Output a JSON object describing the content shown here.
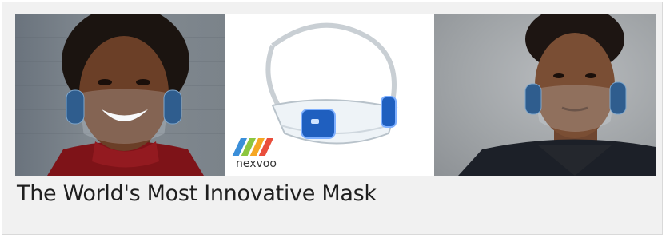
{
  "card": {
    "title": "The World's Most Innovative Mask"
  },
  "images": [
    {
      "name": "woman-wearing-mask"
    },
    {
      "name": "mask-product"
    },
    {
      "name": "man-wearing-mask"
    }
  ],
  "brand": {
    "logo_text": "nexvoo"
  }
}
